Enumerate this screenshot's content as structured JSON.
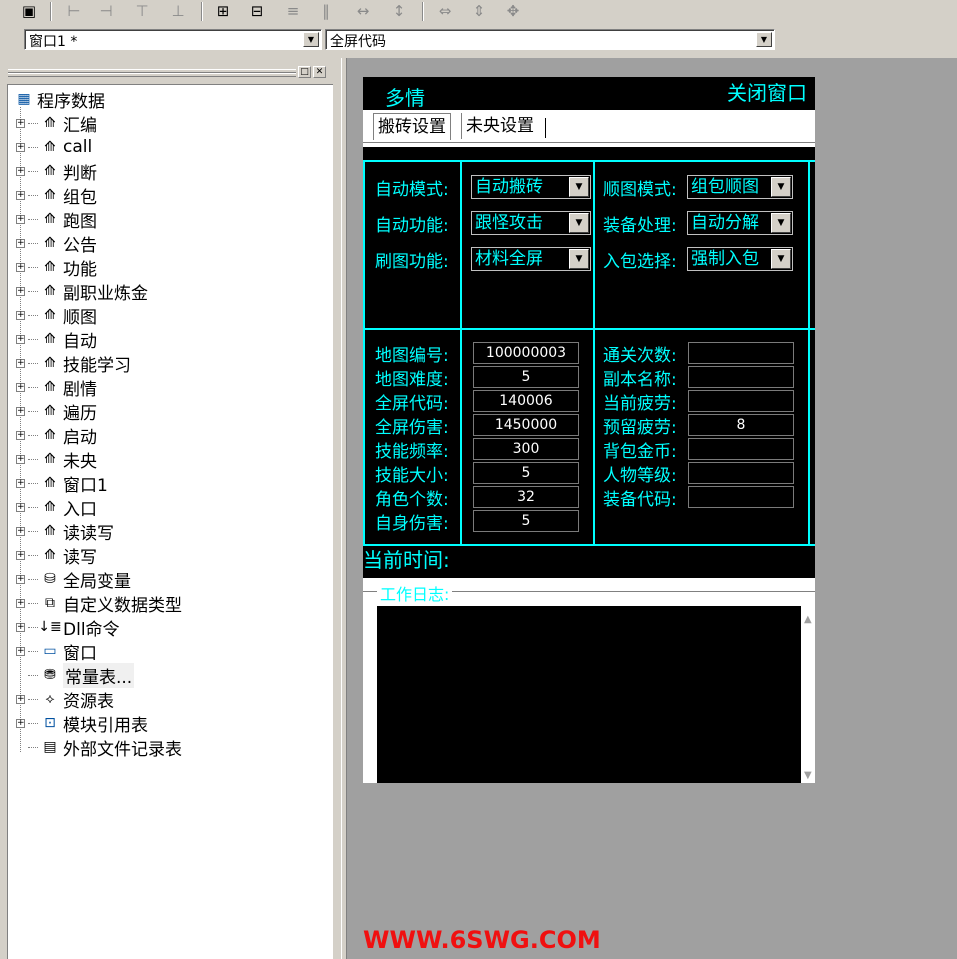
{
  "toolbar": {
    "buttons": [
      "grid-icon",
      "align-left-icon",
      "align-right-icon",
      "align-top-icon",
      "align-bottom-icon",
      "center-h-icon",
      "center-v-icon",
      "same-width-icon",
      "same-height-icon",
      "spacing-h-icon",
      "spacing-v-icon",
      "size-h-icon",
      "size-v-icon",
      "size-both-icon"
    ]
  },
  "window_combo": {
    "value": "窗口1 *"
  },
  "event_combo": {
    "value": "全屏代码"
  },
  "tree": {
    "root": "程序数据",
    "items": [
      "汇编",
      "call",
      "判断",
      "组包",
      "跑图",
      "公告",
      "功能",
      "副职业炼金",
      "顺图",
      "自动",
      "技能学习",
      "剧情",
      "遍历",
      "启动",
      "未央",
      "窗口1",
      "入口",
      "读读写",
      "读写"
    ],
    "global_var": "全局变量",
    "custom_type": "自定义数据类型",
    "dll_cmd": "Dll命令",
    "window": "窗口",
    "const_table": "常量表...",
    "resource_table": "资源表",
    "module_ref": "模块引用表",
    "ext_file": "外部文件记录表"
  },
  "form": {
    "title": "多情",
    "close": "关闭窗口",
    "tabs": [
      "搬砖设置",
      "未央设置"
    ],
    "settings": [
      {
        "label": "自动模式:",
        "value": "自动搬砖"
      },
      {
        "label": "自动功能:",
        "value": "跟怪攻击"
      },
      {
        "label": "刷图功能:",
        "value": "材料全屏"
      }
    ],
    "settings_right": [
      {
        "label": "顺图模式:",
        "value": "组包顺图"
      },
      {
        "label": "装备处理:",
        "value": "自动分解"
      },
      {
        "label": "入包选择:",
        "value": "强制入包"
      }
    ],
    "info_left": [
      {
        "label": "地图编号:",
        "value": "100000003"
      },
      {
        "label": "地图难度:",
        "value": "5"
      },
      {
        "label": "全屏代码:",
        "value": "140006"
      },
      {
        "label": "全屏伤害:",
        "value": "1450000"
      },
      {
        "label": "技能频率:",
        "value": "300"
      },
      {
        "label": "技能大小:",
        "value": "5"
      },
      {
        "label": "角色个数:",
        "value": "32"
      },
      {
        "label": "自身伤害:",
        "value": "5"
      }
    ],
    "info_right": [
      {
        "label": "通关次数:",
        "value": ""
      },
      {
        "label": "副本名称:",
        "value": ""
      },
      {
        "label": "当前疲劳:",
        "value": ""
      },
      {
        "label": "预留疲劳:",
        "value": "8"
      },
      {
        "label": "背包金币:",
        "value": ""
      },
      {
        "label": "人物等级:",
        "value": ""
      },
      {
        "label": "装备代码:",
        "value": ""
      }
    ],
    "current_time_label": "当前时间:",
    "log_label": "工作日志:"
  },
  "watermark": "WWW.6SWG.COM"
}
